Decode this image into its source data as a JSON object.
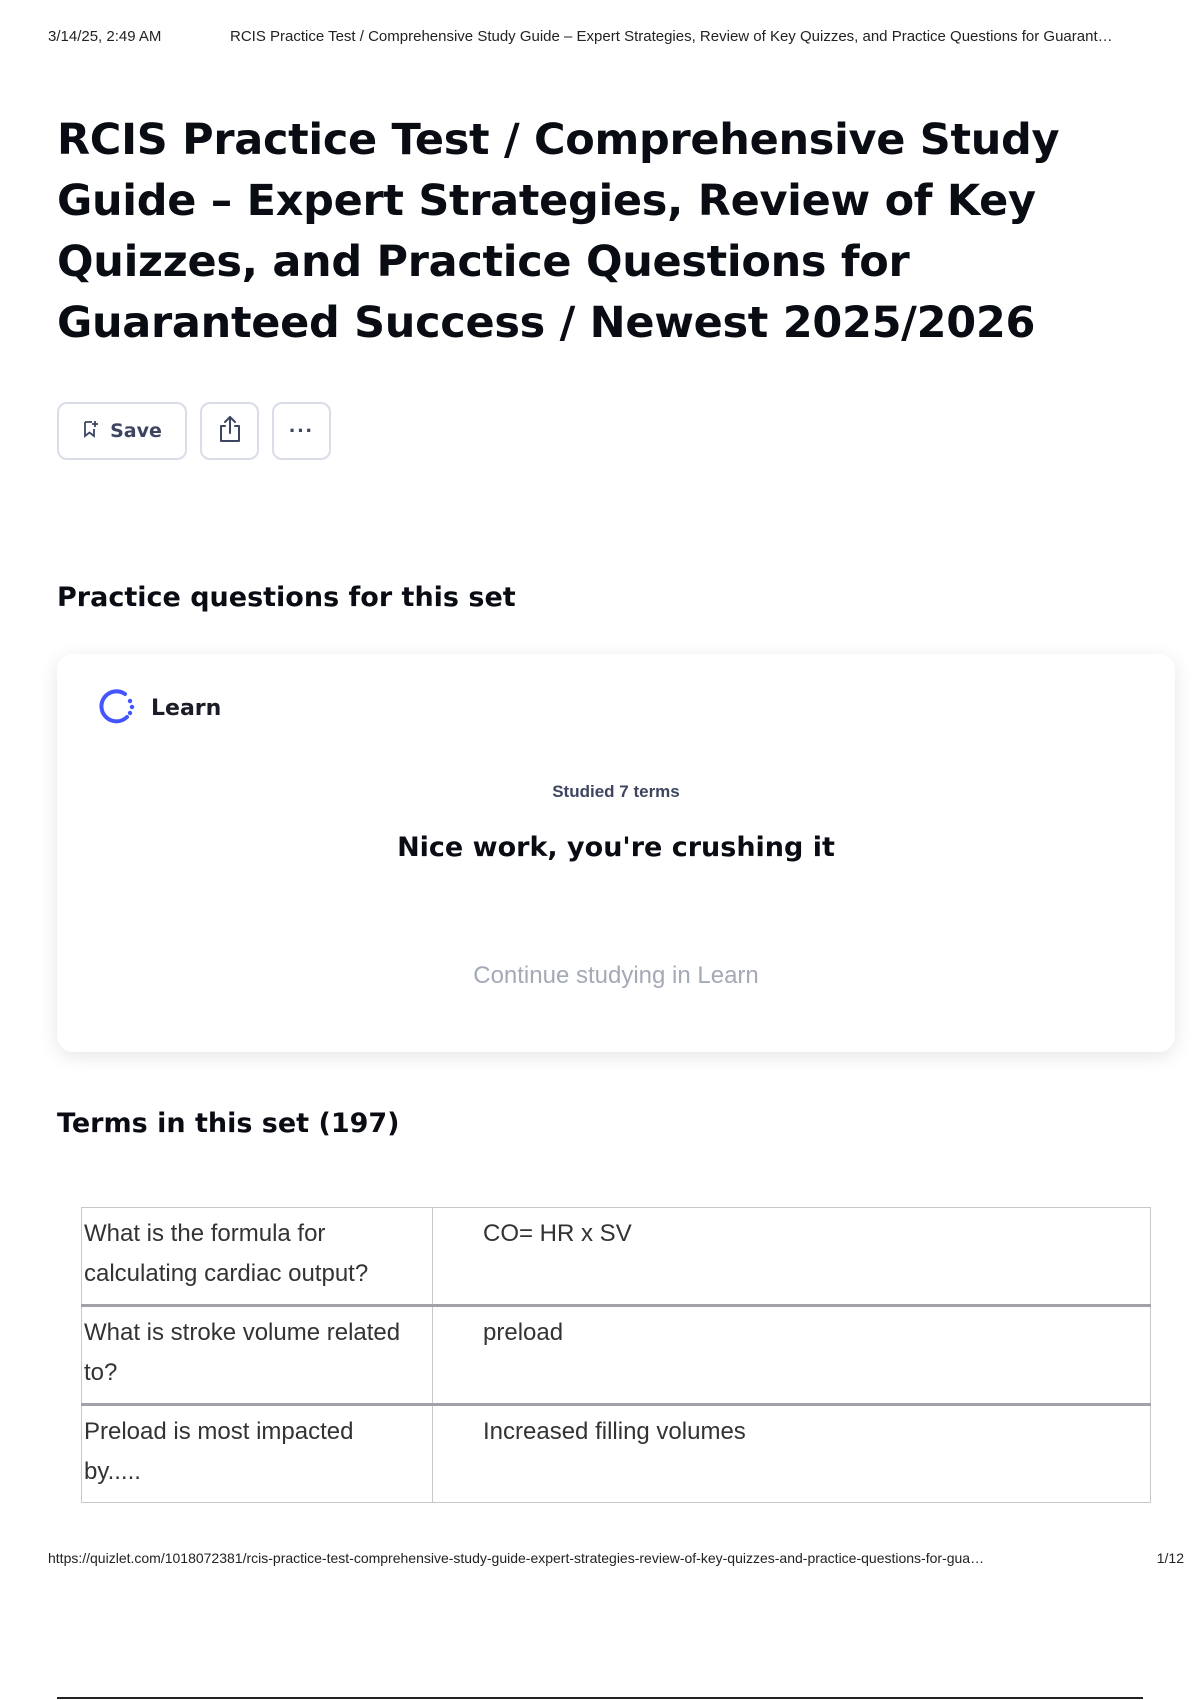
{
  "print_header": {
    "date": "3/14/25, 2:49 AM",
    "doc_title": "RCIS Practice Test / Comprehensive Study Guide – Expert Strategies, Review of Key Quizzes, and Practice Questions for Guarant…"
  },
  "page": {
    "title": "RCIS Practice Test / Comprehensive Study Guide – Expert Strategies, Review of Key Quizzes, and Practice Questions for Guaranteed Success / Newest 2025/2026"
  },
  "toolbar": {
    "save_label": "Save",
    "more_label": "···"
  },
  "practice": {
    "heading": "Practice questions for this set",
    "learn_label": "Learn",
    "studied_text": "Studied 7 terms",
    "message": "Nice work, you're crushing it",
    "continue_label": "Continue studying in Learn"
  },
  "terms": {
    "heading": "Terms in this set (197)",
    "rows": [
      {
        "term": "What is the formula for calculating cardiac output?",
        "definition": "CO= HR x SV"
      },
      {
        "term": "What is stroke volume related to?",
        "definition": "preload"
      },
      {
        "term": "Preload is most impacted by.....",
        "definition": "Increased filling volumes"
      }
    ]
  },
  "print_footer": {
    "url": "https://quizlet.com/1018072381/rcis-practice-test-comprehensive-study-guide-expert-strategies-review-of-key-quizzes-and-practice-questions-for-gua…",
    "page": "1/12"
  },
  "colors": {
    "learn_icon": "#4255ff",
    "muted_text": "#a4a9b6"
  }
}
